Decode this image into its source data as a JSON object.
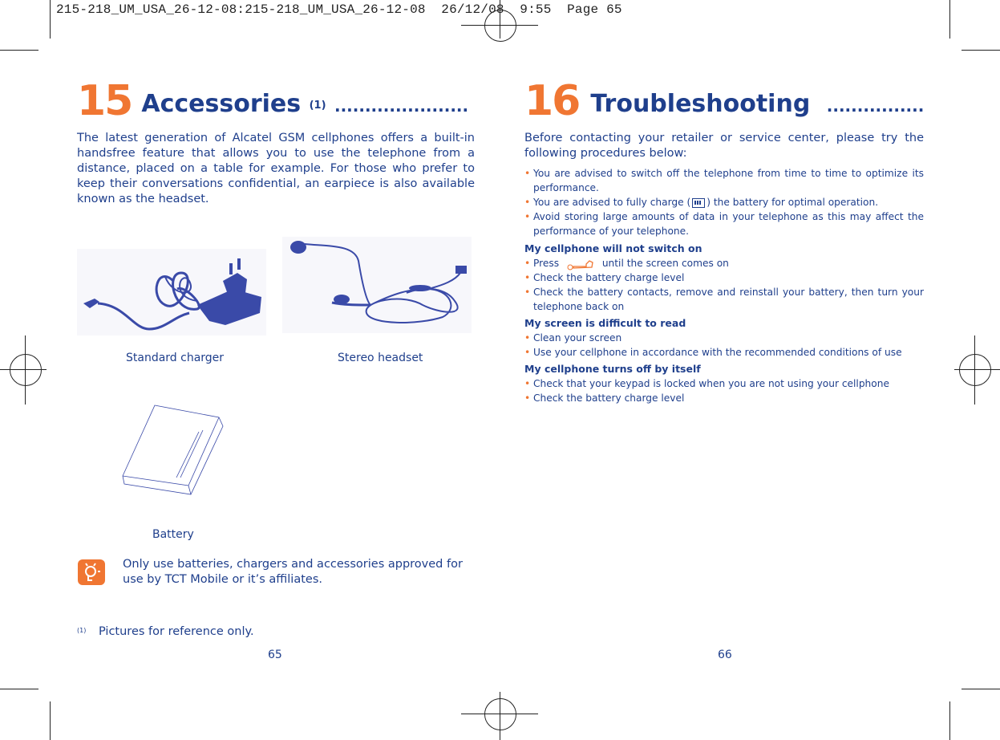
{
  "slug": "215-218_UM_USA_26-12-08:215-218_UM_USA_26-12-08  26/12/08  9:55  Page 65",
  "left_page": {
    "chapter_number": "15",
    "chapter_title": "Accessories",
    "footnote_ref": "(1)",
    "title_leader": "......................",
    "intro": "The latest generation of Alcatel GSM cellphones offers a built-in handsfree feature that allows you to use the telephone from a distance, placed on a table for example. For those who prefer to keep their conversations confidential, an earpiece is also available known as the headset.",
    "images": [
      {
        "icon": "charger-image",
        "caption": "Standard charger"
      },
      {
        "icon": "headset-image",
        "caption": "Stereo headset"
      },
      {
        "icon": "battery-image",
        "caption": "Battery"
      }
    ],
    "tip_icon": "lightbulb-tip-icon",
    "tip_text": "Only use batteries, chargers and accessories approved for use by TCT Mobile or it’s affiliates.",
    "footnote_marker": "(1)",
    "footnote_text": "Pictures for reference only.",
    "page_number": "65"
  },
  "right_page": {
    "chapter_number": "16",
    "chapter_title": "Troubleshooting",
    "title_leader": "................",
    "intro": "Before contacting your retailer or service center, please try the following procedures below:",
    "general_tips": [
      "You are advised to switch off the telephone from time to time to optimize its performance.",
      {
        "before": "You are advised to fully charge (",
        "icon": "battery-full-icon",
        "after": ") the battery for optimal operation."
      },
      "Avoid storing large amounts of data in your telephone as this may affect the performance of your telephone."
    ],
    "sections": [
      {
        "heading": "My cellphone will not switch on",
        "items": [
          {
            "before": "Press",
            "icon": "end-call-power-key-icon",
            "after": "until the screen comes on"
          },
          "Check the battery charge level",
          "Check the battery contacts, remove and reinstall your battery, then turn your telephone back on"
        ]
      },
      {
        "heading": "My screen is difficult to read",
        "items": [
          "Clean your screen",
          "Use your cellphone in accordance with the recommended conditions of use"
        ]
      },
      {
        "heading": "My cellphone turns off by itself",
        "items": [
          "Check that your keypad is locked when you are not using your cellphone",
          "Check the battery charge level"
        ]
      }
    ],
    "page_number": "66"
  },
  "colors": {
    "text_blue": "#1f3f8c",
    "accent_orange": "#f07632",
    "image_blue": "#3a4aa8"
  }
}
